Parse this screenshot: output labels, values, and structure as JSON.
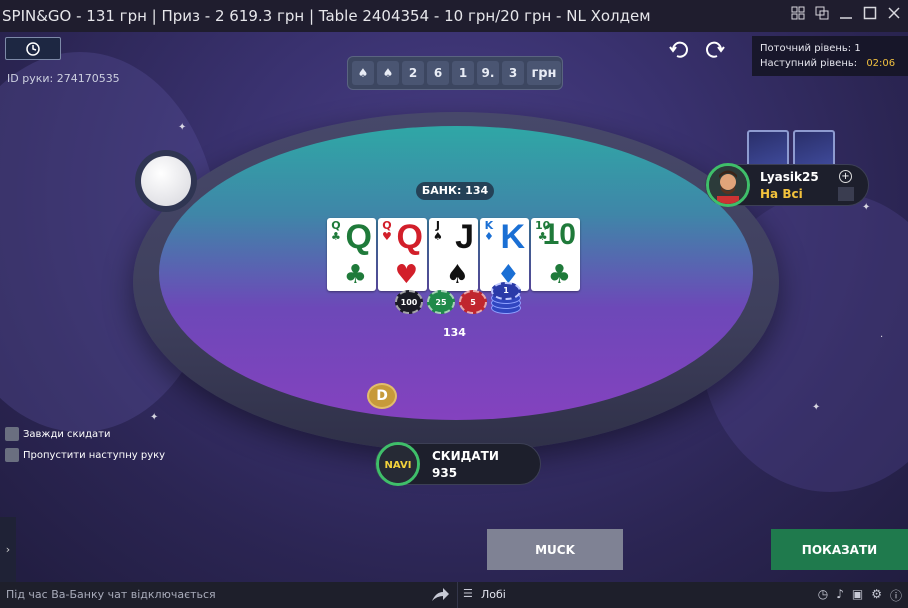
{
  "window": {
    "title": "SPIN&GO - 131 грн | Приз - 2 619.3 грн | Table 2404354 - 10 грн/20 грн - NL Холдем",
    "controls": [
      "tile-icon",
      "restore-icon",
      "minimize-icon",
      "maximize-icon",
      "close-icon"
    ]
  },
  "hand_id": "ID руки: 274170535",
  "card_strip": {
    "cells": [
      "2",
      "6",
      "1",
      "9.",
      "3"
    ],
    "currency": "грн"
  },
  "level": {
    "current_label": "Поточний рівень: 1",
    "next_label": "Наступний рівень:",
    "next_time": "02:06"
  },
  "table": {
    "bank_label": "БАНК: 134",
    "pot_amount": "134",
    "chips": [
      "100",
      "25",
      "5",
      "1"
    ],
    "dealer_label": "D"
  },
  "board": [
    {
      "rank": "Q",
      "suit": "♣",
      "color": "#1f7a3a"
    },
    {
      "rank": "Q",
      "suit": "♥",
      "color": "#d21f2a"
    },
    {
      "rank": "J",
      "suit": "♠",
      "color": "#111111"
    },
    {
      "rank": "K",
      "suit": "♦",
      "color": "#1a6fd4"
    },
    {
      "rank": "10",
      "suit": "♣",
      "color": "#1f7a3a"
    }
  ],
  "opponent": {
    "name": "Lyasik25",
    "status": "На Всі"
  },
  "hero": {
    "action": "СКИДАТИ",
    "stack": "935"
  },
  "options": {
    "always_fold": "Завжди скидати",
    "skip_next": "Пропустити наступну руку"
  },
  "buttons": {
    "muck": "MUCK",
    "show": "ПОКАЗАТИ"
  },
  "bottom": {
    "chat_notice": "Під час Ва-Банку чат відключається",
    "lobby": "Лобі"
  },
  "colors": {
    "show_button": "#1f7a4d",
    "muck_button": "#7f8294",
    "status_yellow": "#f3c23c",
    "avatar_ring": "#3fbf6a"
  }
}
